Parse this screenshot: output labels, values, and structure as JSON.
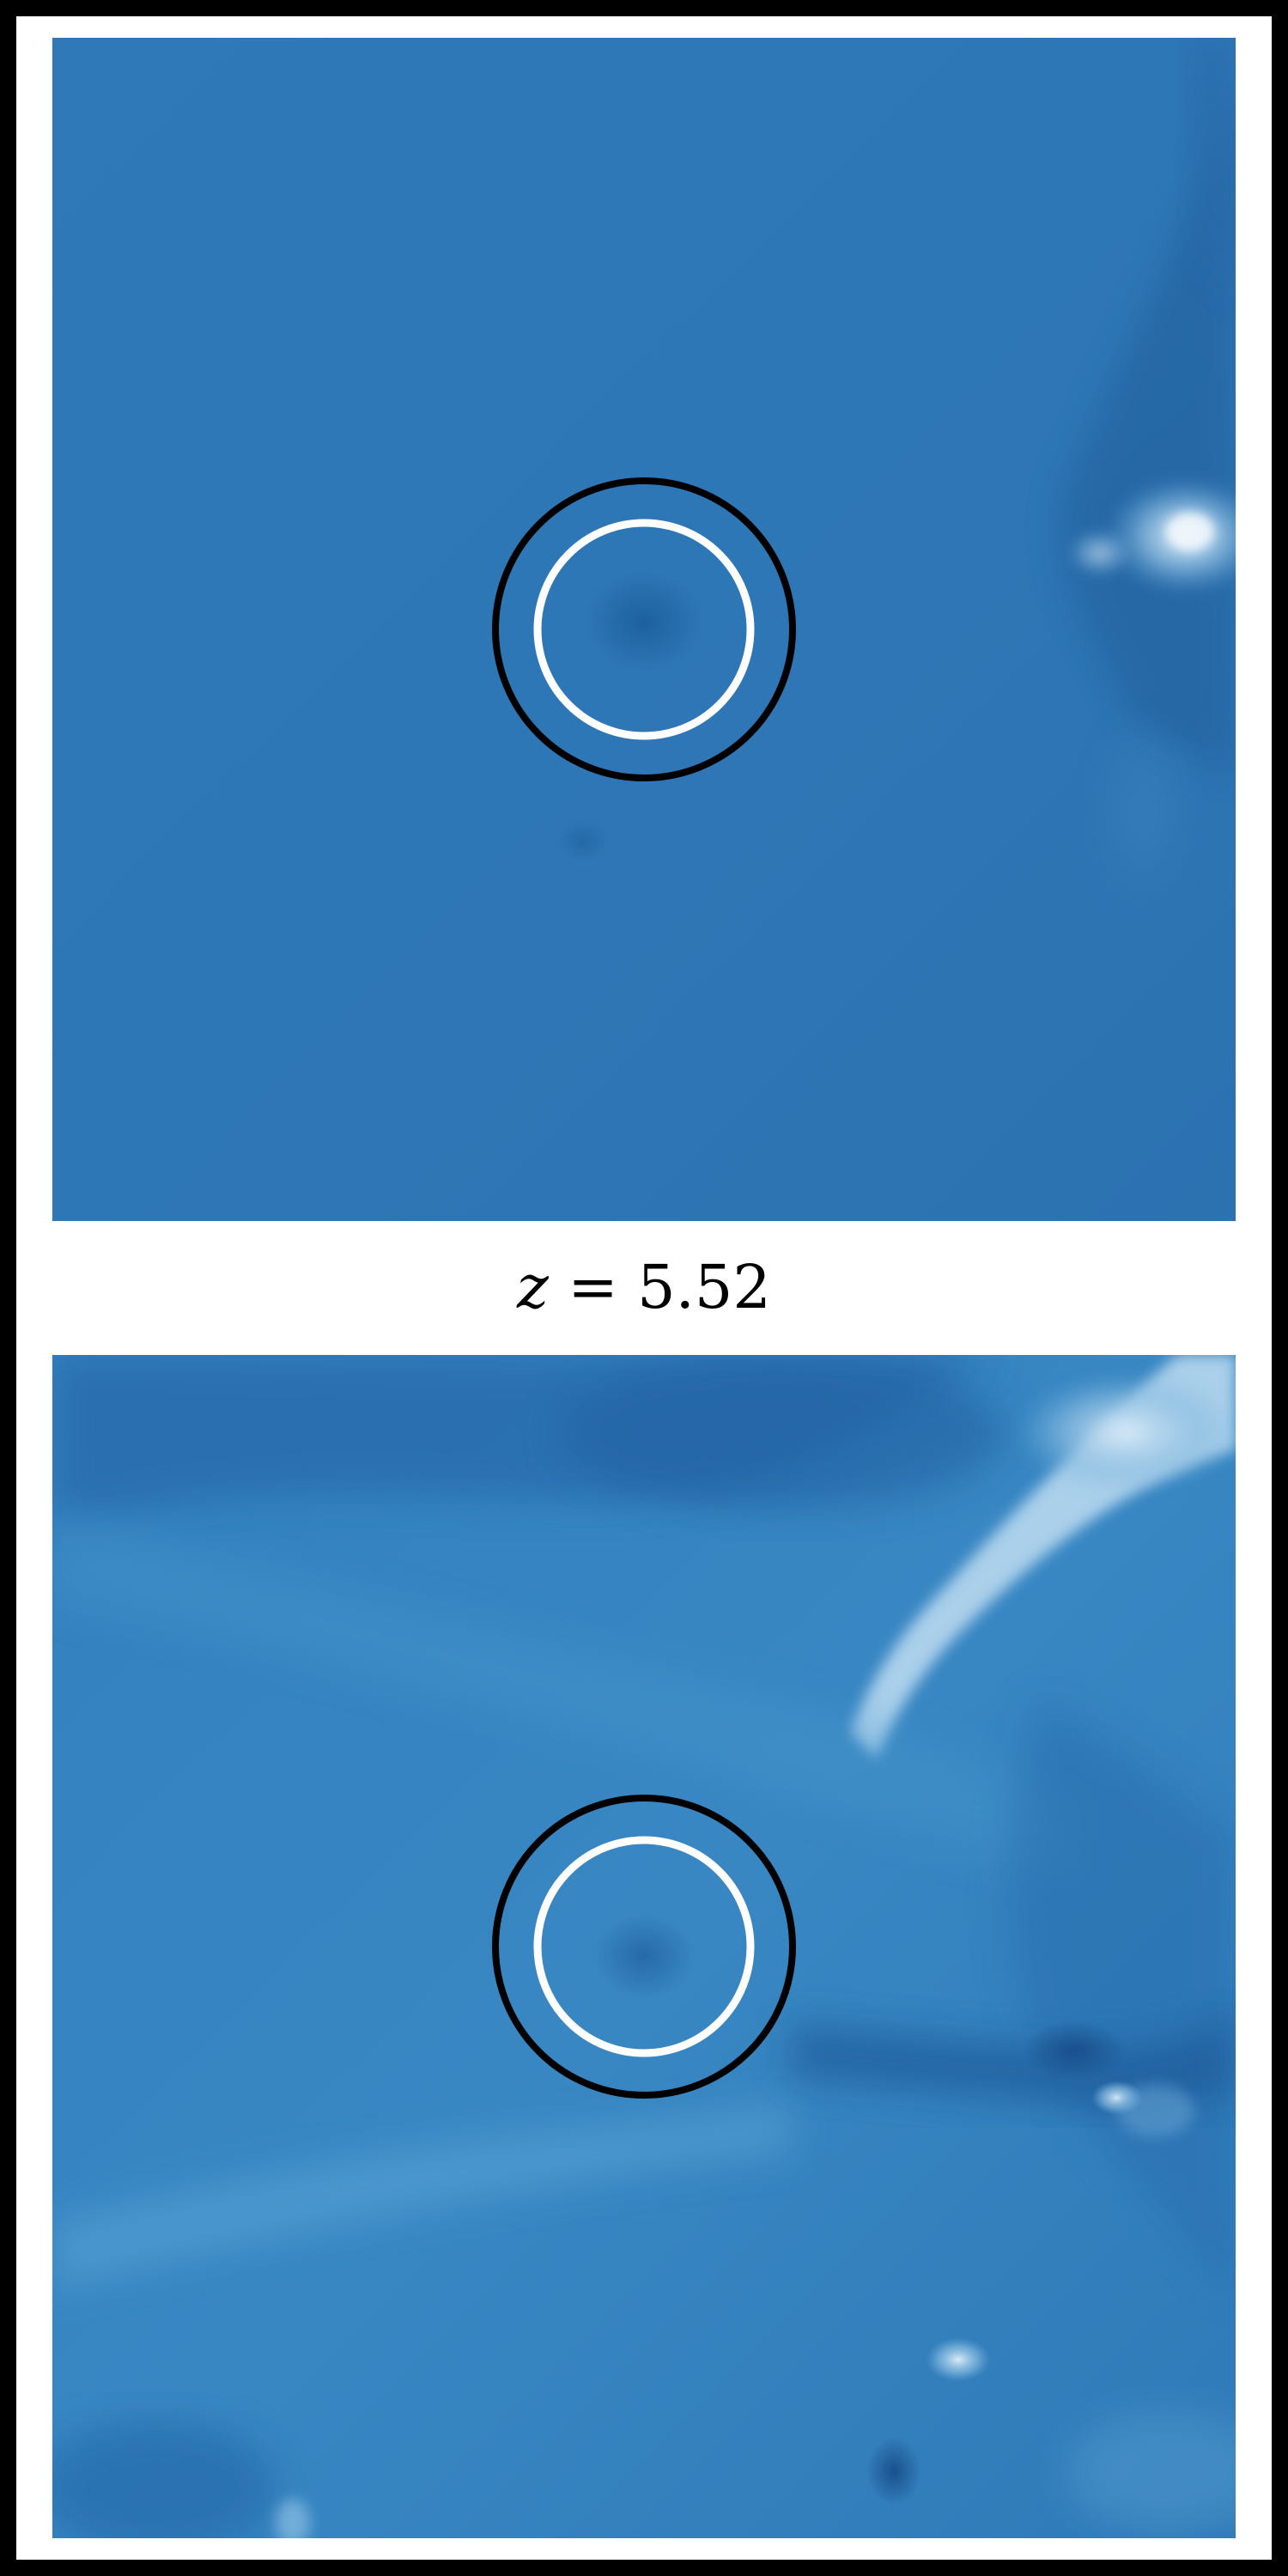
{
  "figure": {
    "label_variable": "z",
    "label_operator": "=",
    "label_value": "5.52"
  },
  "colors": {
    "frame": "#000000",
    "background": "#ffffff",
    "panel_base": "#2f78b7",
    "outer_ring": "#000000",
    "inner_ring": "#ffffff"
  }
}
